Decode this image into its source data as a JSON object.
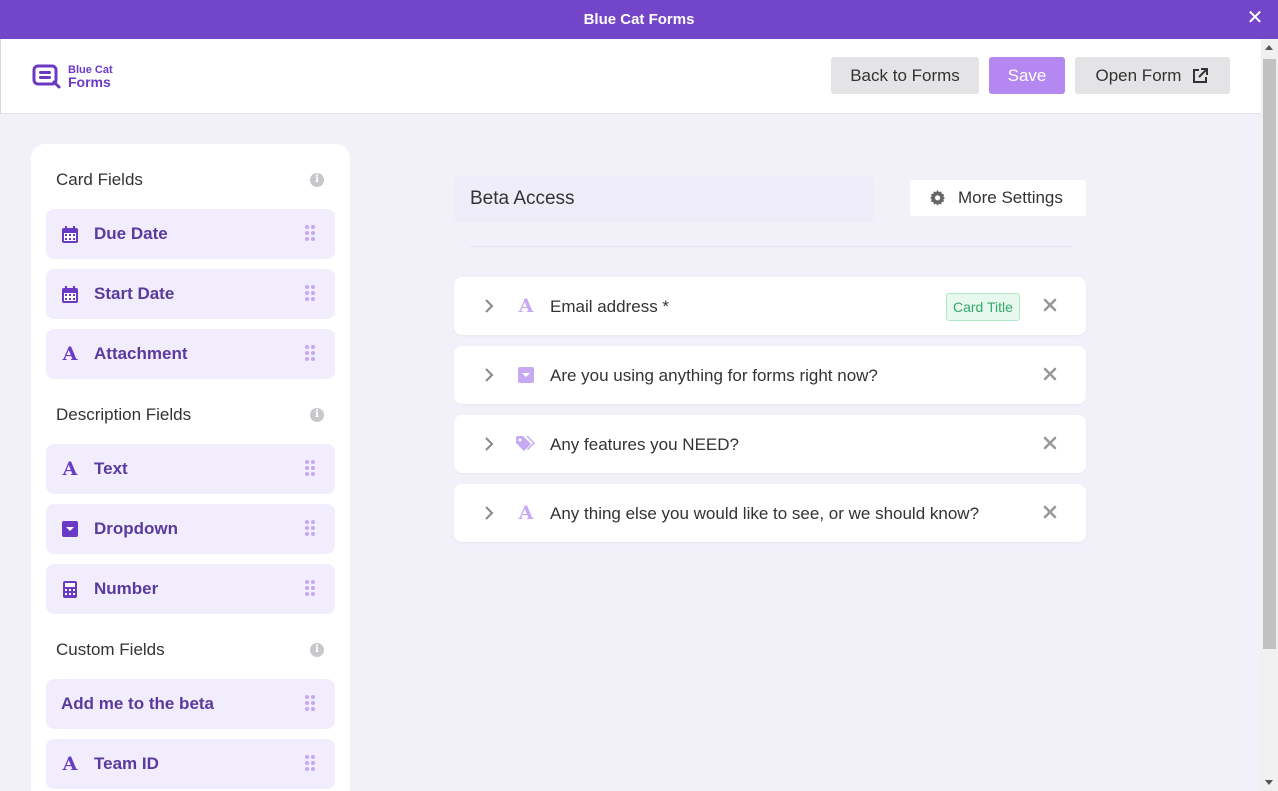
{
  "window": {
    "title": "Blue Cat Forms"
  },
  "logo": {
    "line1": "Blue Cat",
    "line2": "Forms"
  },
  "toolbar": {
    "back_label": "Back to Forms",
    "save_label": "Save",
    "open_label": "Open Form"
  },
  "sidebar": {
    "card_fields": {
      "title": "Card Fields",
      "items": [
        {
          "label": "Due Date",
          "icon": "calendar-icon"
        },
        {
          "label": "Start Date",
          "icon": "calendar-icon"
        },
        {
          "label": "Attachment",
          "icon": "text-icon"
        }
      ]
    },
    "description_fields": {
      "title": "Description Fields",
      "items": [
        {
          "label": "Text",
          "icon": "text-icon"
        },
        {
          "label": "Dropdown",
          "icon": "dropdown-icon"
        },
        {
          "label": "Number",
          "icon": "calculator-icon"
        }
      ]
    },
    "custom_fields": {
      "title": "Custom Fields",
      "items": [
        {
          "label": "Add me to the beta",
          "icon": ""
        },
        {
          "label": "Team ID",
          "icon": "text-icon"
        }
      ]
    }
  },
  "form": {
    "name": "Beta Access",
    "more_settings_label": "More Settings",
    "questions": [
      {
        "label": "Email address *",
        "icon": "text-icon",
        "badge": "Card Title"
      },
      {
        "label": "Are you using anything for forms right now?",
        "icon": "dropdown-icon",
        "badge": ""
      },
      {
        "label": "Any features you NEED?",
        "icon": "tag-icon",
        "badge": ""
      },
      {
        "label": "Any thing else you would like to see, or we should know?",
        "icon": "text-icon",
        "badge": ""
      }
    ]
  },
  "colors": {
    "accent": "#7345c9",
    "save": "#b488f0",
    "field_bg": "#f1edfd",
    "badge_green": "#34a867"
  }
}
